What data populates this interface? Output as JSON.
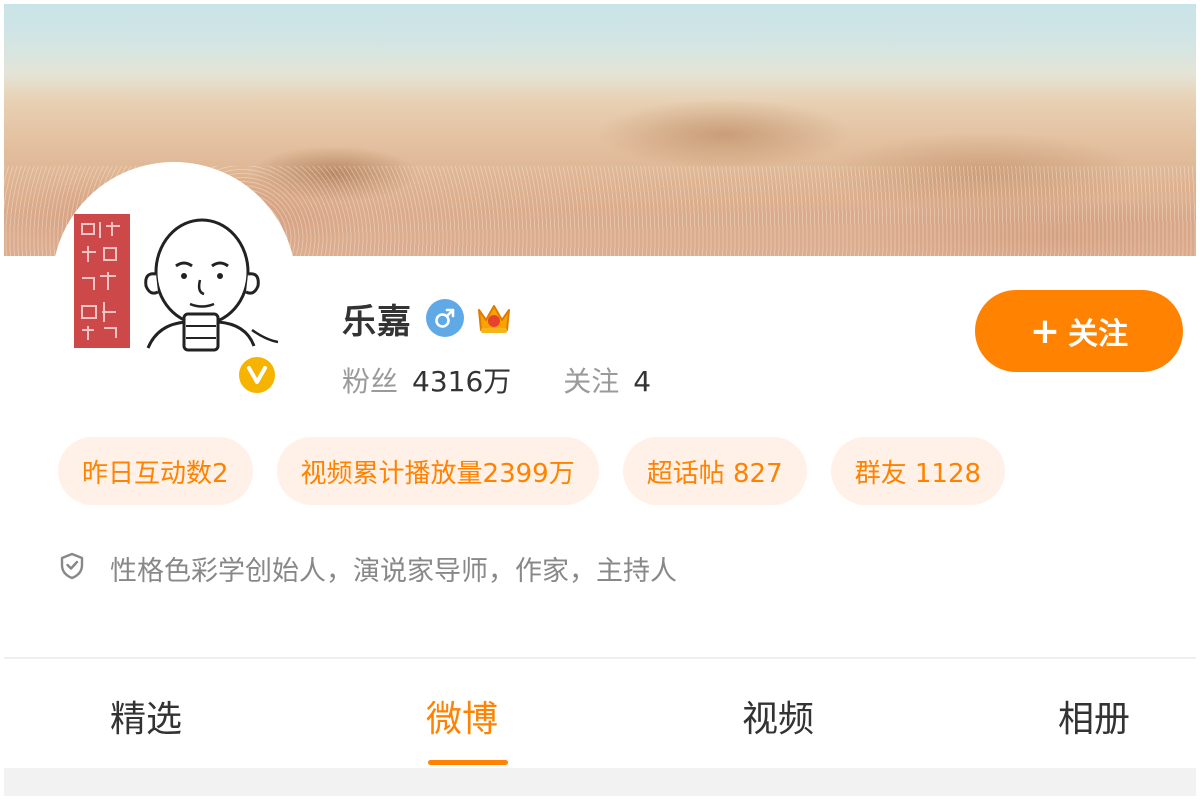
{
  "profile": {
    "name": "乐嘉",
    "gender_icon": "male-icon",
    "member_icon": "crown-icon",
    "verified_icon": "verified-v-icon",
    "avatar_seal_text": "性格色彩创始人",
    "followers_label": "粉丝",
    "followers_value": "4316万",
    "following_label": "关注",
    "following_value": "4"
  },
  "follow_button": {
    "icon": "plus-icon",
    "label": "关注"
  },
  "tags": [
    {
      "label": "昨日互动数2"
    },
    {
      "label": "视频累计播放量2399万"
    },
    {
      "label": "超话帖 827"
    },
    {
      "label": "群友 1128"
    }
  ],
  "bio": {
    "icon": "shield-icon",
    "text": "性格色彩学创始人，演说家导师，作家，主持人"
  },
  "tabs": [
    {
      "label": "精选",
      "active": false
    },
    {
      "label": "微博",
      "active": true
    },
    {
      "label": "视频",
      "active": false
    },
    {
      "label": "相册",
      "active": false
    }
  ],
  "colors": {
    "accent": "#ff8200",
    "tag_bg": "#fff1e8",
    "verified": "#f6b400",
    "gender_male": "#5fa9e6",
    "seal_red": "#c9383a"
  }
}
